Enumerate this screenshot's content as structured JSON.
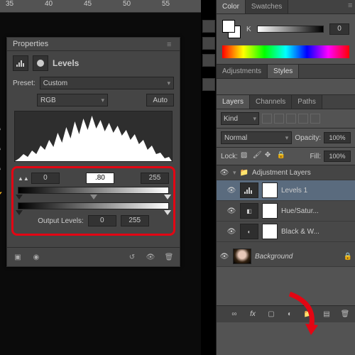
{
  "ruler": [
    "35",
    "40",
    "45",
    "50",
    "55"
  ],
  "properties": {
    "tab": "Properties",
    "title": "Levels",
    "preset_label": "Preset:",
    "preset_value": "Custom",
    "channel_value": "RGB",
    "auto": "Auto",
    "input": {
      "black": "0",
      "gamma": ".80",
      "white": "255"
    },
    "output_label": "Output Levels:",
    "output": {
      "black": "0",
      "white": "255"
    }
  },
  "color_panel": {
    "tabs": [
      "Color",
      "Swatches"
    ],
    "k_label": "K",
    "k_value": "0"
  },
  "adjust_tabs": [
    "Adjustments",
    "Styles"
  ],
  "layers_panel": {
    "tabs": [
      "Layers",
      "Channels",
      "Paths"
    ],
    "kind": "Kind",
    "blend": "Normal",
    "opacity_label": "Opacity:",
    "opacity": "100%",
    "lock_label": "Lock:",
    "fill_label": "Fill:",
    "fill": "100%",
    "group": "Adjustment Layers",
    "layers": [
      {
        "name": "Levels 1",
        "type": "levels",
        "sel": true
      },
      {
        "name": "Hue/Satur...",
        "type": "hue"
      },
      {
        "name": "Black & W...",
        "type": "bw"
      }
    ],
    "background": "Background"
  }
}
